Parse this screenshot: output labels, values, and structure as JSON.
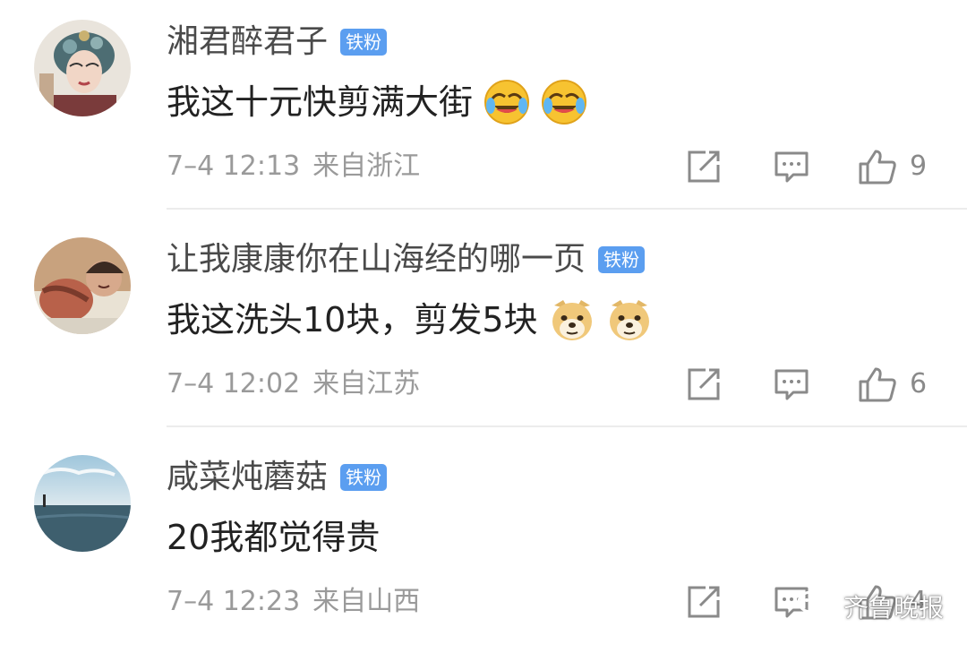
{
  "comments": [
    {
      "username": "湘君醉君子",
      "badge": "铁粉",
      "text": "我这十元快剪满大街",
      "emojis": [
        "laugh-cry-emoji",
        "laugh-cry-emoji"
      ],
      "time": "7–4 12:13",
      "location": "来自浙江",
      "likes": "9"
    },
    {
      "username": "让我康康你在山海经的哪一页",
      "badge": "铁粉",
      "text": "我这洗头10块，剪发5块",
      "emojis": [
        "doge-emoji",
        "doge-emoji"
      ],
      "time": "7–4 12:02",
      "location": "来自江苏",
      "likes": "6"
    },
    {
      "username": "咸菜炖蘑菇",
      "badge": "铁粉",
      "text": "20我都觉得贵",
      "emojis": [],
      "time": "7–4 12:23",
      "location": "来自山西",
      "likes": "4"
    }
  ],
  "watermark": {
    "text": "齐鲁晚报",
    "icon": "wechat-icon"
  },
  "colors": {
    "badge": "#5b9ef0",
    "meta": "#9a9a9a",
    "username": "#4a4a4a",
    "text": "#222222"
  }
}
